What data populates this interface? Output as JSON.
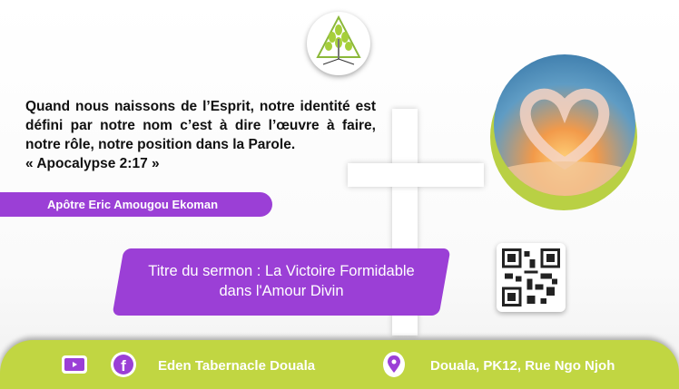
{
  "quote": {
    "text": "Quand nous naissons de l’Esprit, notre identité est défini par notre nom c’est à dire l’œuvre à faire, notre rôle, notre position dans la Parole.",
    "reference": "« Apocalypse 2:17 »"
  },
  "author": "Apôtre Eric Amougou Ekoman",
  "sermon": {
    "line1": "Titre du sermon : La Victoire Formidable",
    "line2": "dans l'Amour Divin"
  },
  "footer": {
    "church": "Eden Tabernacle Douala",
    "address": "Douala, PK12, Rue Ngo Njoh",
    "icons": [
      "youtube-icon",
      "facebook-icon",
      "location-pin-icon"
    ]
  },
  "colors": {
    "purple": "#9b3fd6",
    "green": "#c1d642"
  }
}
